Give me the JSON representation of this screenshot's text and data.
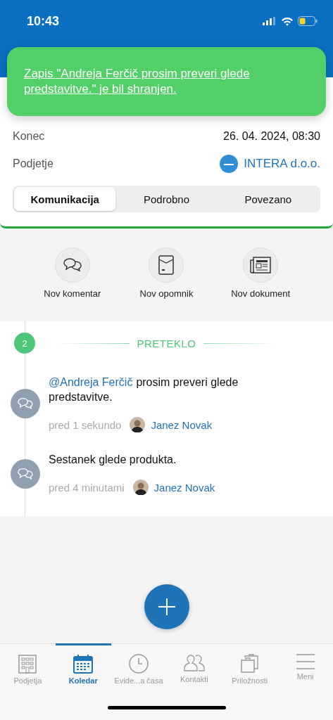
{
  "status_bar": {
    "time": "10:43"
  },
  "toast": {
    "message": "Zapis \"Andreja Ferčič prosim preveri glede predstavitve.\" je bil shranjen."
  },
  "details": [
    {
      "label": "Konec",
      "value": "26. 04. 2024, 08:30",
      "kind": "text"
    },
    {
      "label": "Podjetje",
      "value": "INTERA d.o.o.",
      "kind": "company"
    }
  ],
  "segments": [
    {
      "label": "Komunikacija",
      "selected": true
    },
    {
      "label": "Podrobno",
      "selected": false
    },
    {
      "label": "Povezano",
      "selected": false
    }
  ],
  "actions": [
    {
      "label": "Nov komentar",
      "kind": "comment"
    },
    {
      "label": "Nov opomnik",
      "kind": "reminder"
    },
    {
      "label": "Nov dokument",
      "kind": "document"
    }
  ],
  "timeline": {
    "count": "2",
    "section": "PRETEKLO",
    "entries": [
      {
        "mention": "@Andreja Ferčič",
        "text": "prosim preveri glede predstavitve.",
        "time": "pred 1 sekundo",
        "author": "Janez Novak"
      },
      {
        "text": "Sestanek glede produkta.",
        "time": "pred 4 minutami",
        "author": "Janez Novak"
      }
    ]
  },
  "tabs": [
    {
      "label": "Podjetja",
      "kind": "building",
      "selected": false
    },
    {
      "label": "Koledar",
      "kind": "calendar",
      "selected": true
    },
    {
      "label": "Evide...a časa",
      "kind": "clock",
      "selected": false
    },
    {
      "label": "Kontakti",
      "kind": "people",
      "selected": false
    },
    {
      "label": "Priložnosti",
      "kind": "cases",
      "selected": false
    },
    {
      "label": "Meni",
      "kind": "menu",
      "selected": false
    }
  ]
}
